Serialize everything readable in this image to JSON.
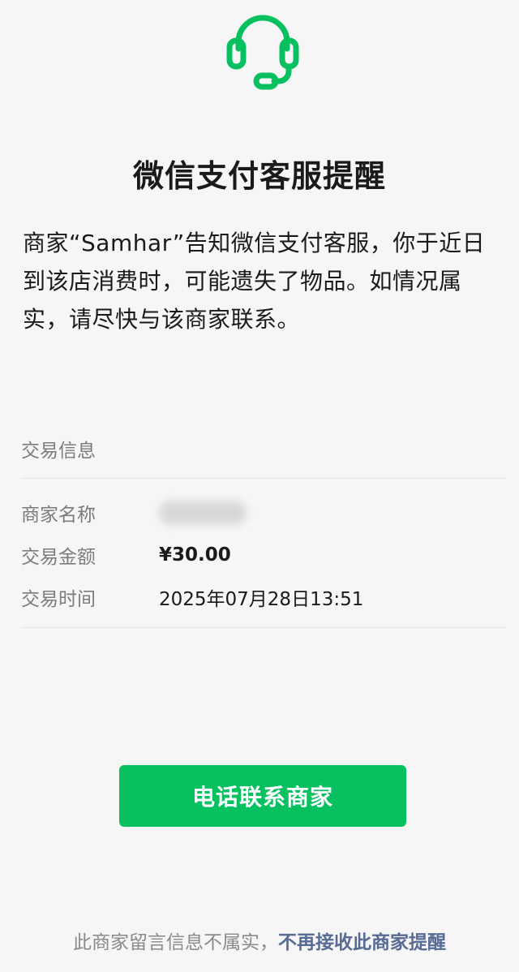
{
  "header": {
    "icon": "headset-icon",
    "title": "微信支付客服提醒"
  },
  "message": "商家“Samhar”告知微信支付客服，你于近日到该店消费时，可能遗失了物品。如情况属实，请尽快与该商家联系。",
  "transaction": {
    "section_label": "交易信息",
    "merchant_label": "商家名称",
    "amount_label": "交易金额",
    "amount_value": "¥30.00",
    "time_label": "交易时间",
    "time_value": "2025年07月28日13:51"
  },
  "actions": {
    "call_label": "电话联系商家"
  },
  "footer": {
    "note": "此商家留言信息不属实，",
    "link": "不再接收此商家提醒"
  },
  "colors": {
    "accent": "#07c160",
    "link": "#576b95",
    "background": "#f6f6f6"
  }
}
